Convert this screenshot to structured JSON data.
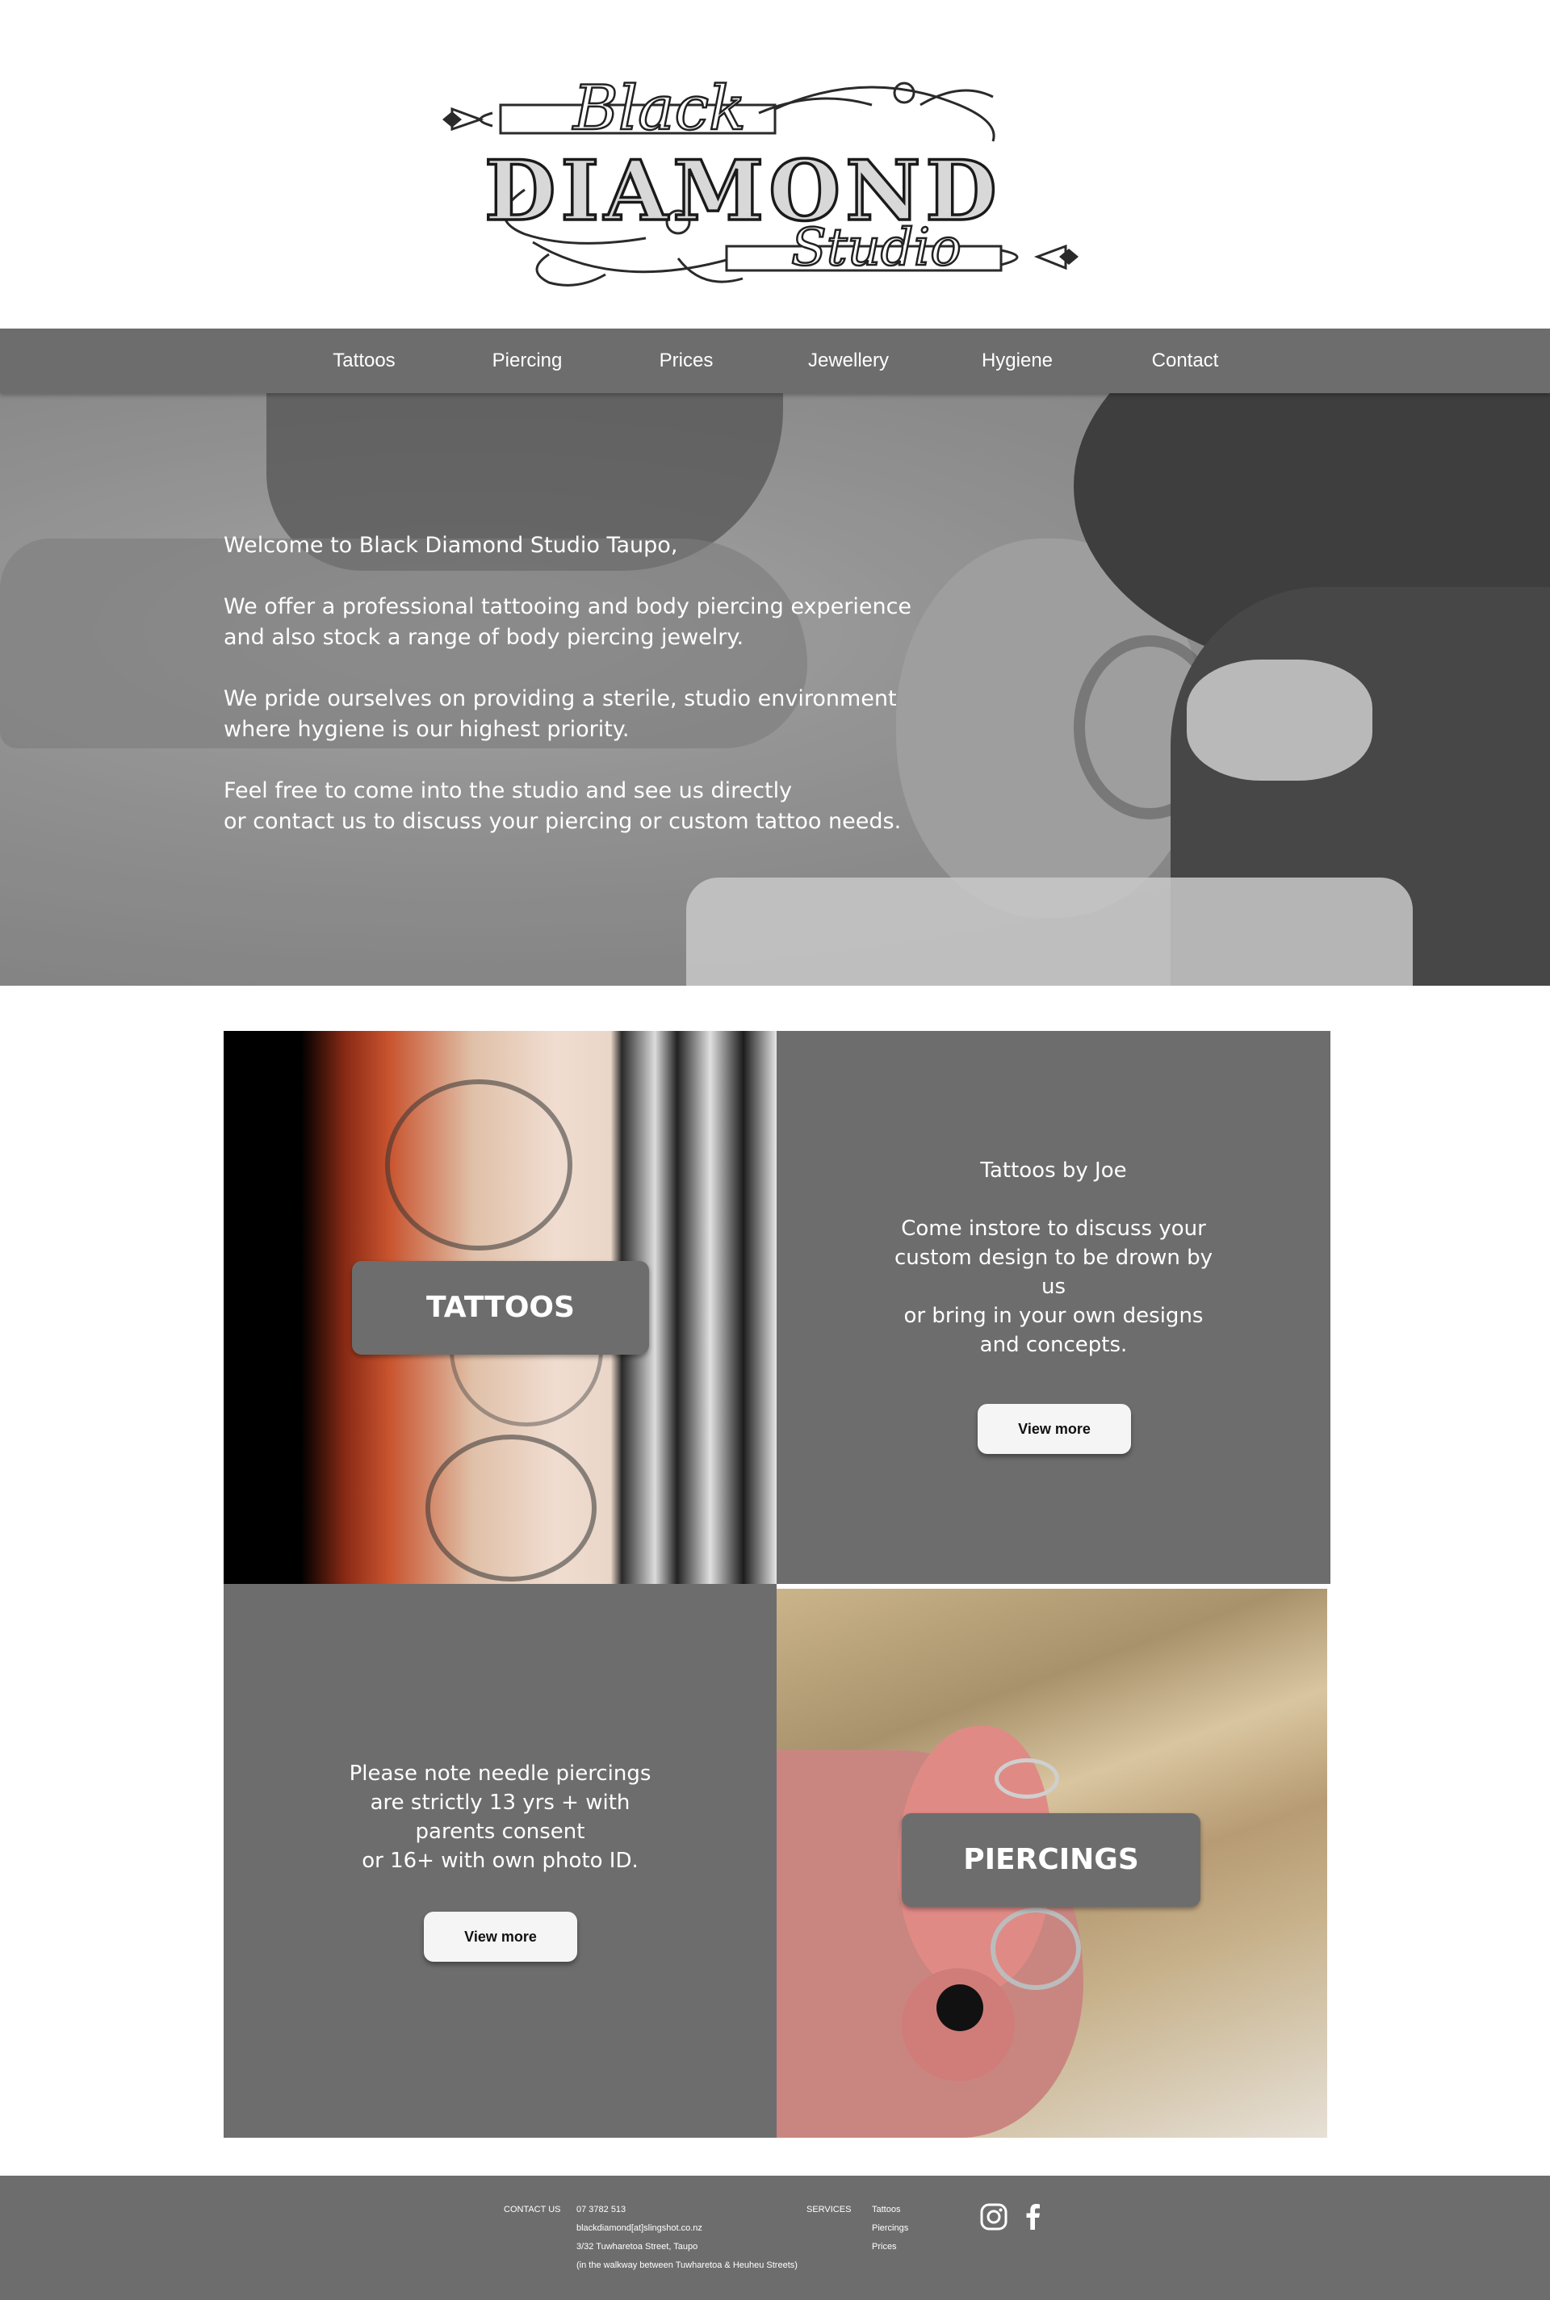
{
  "logo": {
    "word1": "Black",
    "word2": "DIAMOND",
    "word3": "Studio"
  },
  "nav": {
    "items": [
      "Tattoos",
      "Piercing",
      "Prices",
      "Jewellery",
      "Hygiene",
      "Contact"
    ]
  },
  "hero": {
    "welcome": "Welcome to Black Diamond Studio Taupo,",
    "para1_line1": "We offer a professional tattooing and body piercing experience",
    "para1_line2": "and also stock a range of body piercing jewelry.",
    "para2_line1": "We pride ourselves on providing a sterile, studio environment",
    "para2_line2": "where hygiene is our highest priority.",
    "para3_line1": "Feel free to come into the studio and see us directly",
    "para3_line2": "or contact us to discuss your piercing or custom tattoo needs."
  },
  "tattoos": {
    "label": "TATTOOS",
    "heading": "Tattoos by Joe",
    "line1": "Come instore to discuss your",
    "line2": "custom design to be drown by",
    "line3": "us",
    "line4": "or bring in your own designs",
    "line5": "and concepts.",
    "button": "View more"
  },
  "piercings": {
    "label": "PIERCINGS",
    "line1": "Please note needle piercings",
    "line2": "are strictly 13 yrs + with",
    "line3": "parents consent",
    "line4": "or 16+ with own photo ID.",
    "button": "View more"
  },
  "footer": {
    "contact_heading": "CONTACT US",
    "phone": "07 3782 513",
    "email": "blackdiamond[at]slingshot.co.nz",
    "address": "3/32 Tuwharetoa Street, Taupo",
    "address_note": "(in the walkway between Tuwharetoa & Heuheu Streets)",
    "services_heading": "SERVICES",
    "services": [
      "Tattoos",
      "Piercings",
      "Prices"
    ]
  },
  "social": {
    "icons": [
      "instagram-icon",
      "facebook-icon"
    ]
  },
  "colors": {
    "nav_bg": "#6d6d6d",
    "panel_bg": "#6d6d6d",
    "button_bg": "#f5f5f5",
    "text_light": "#ffffff"
  }
}
